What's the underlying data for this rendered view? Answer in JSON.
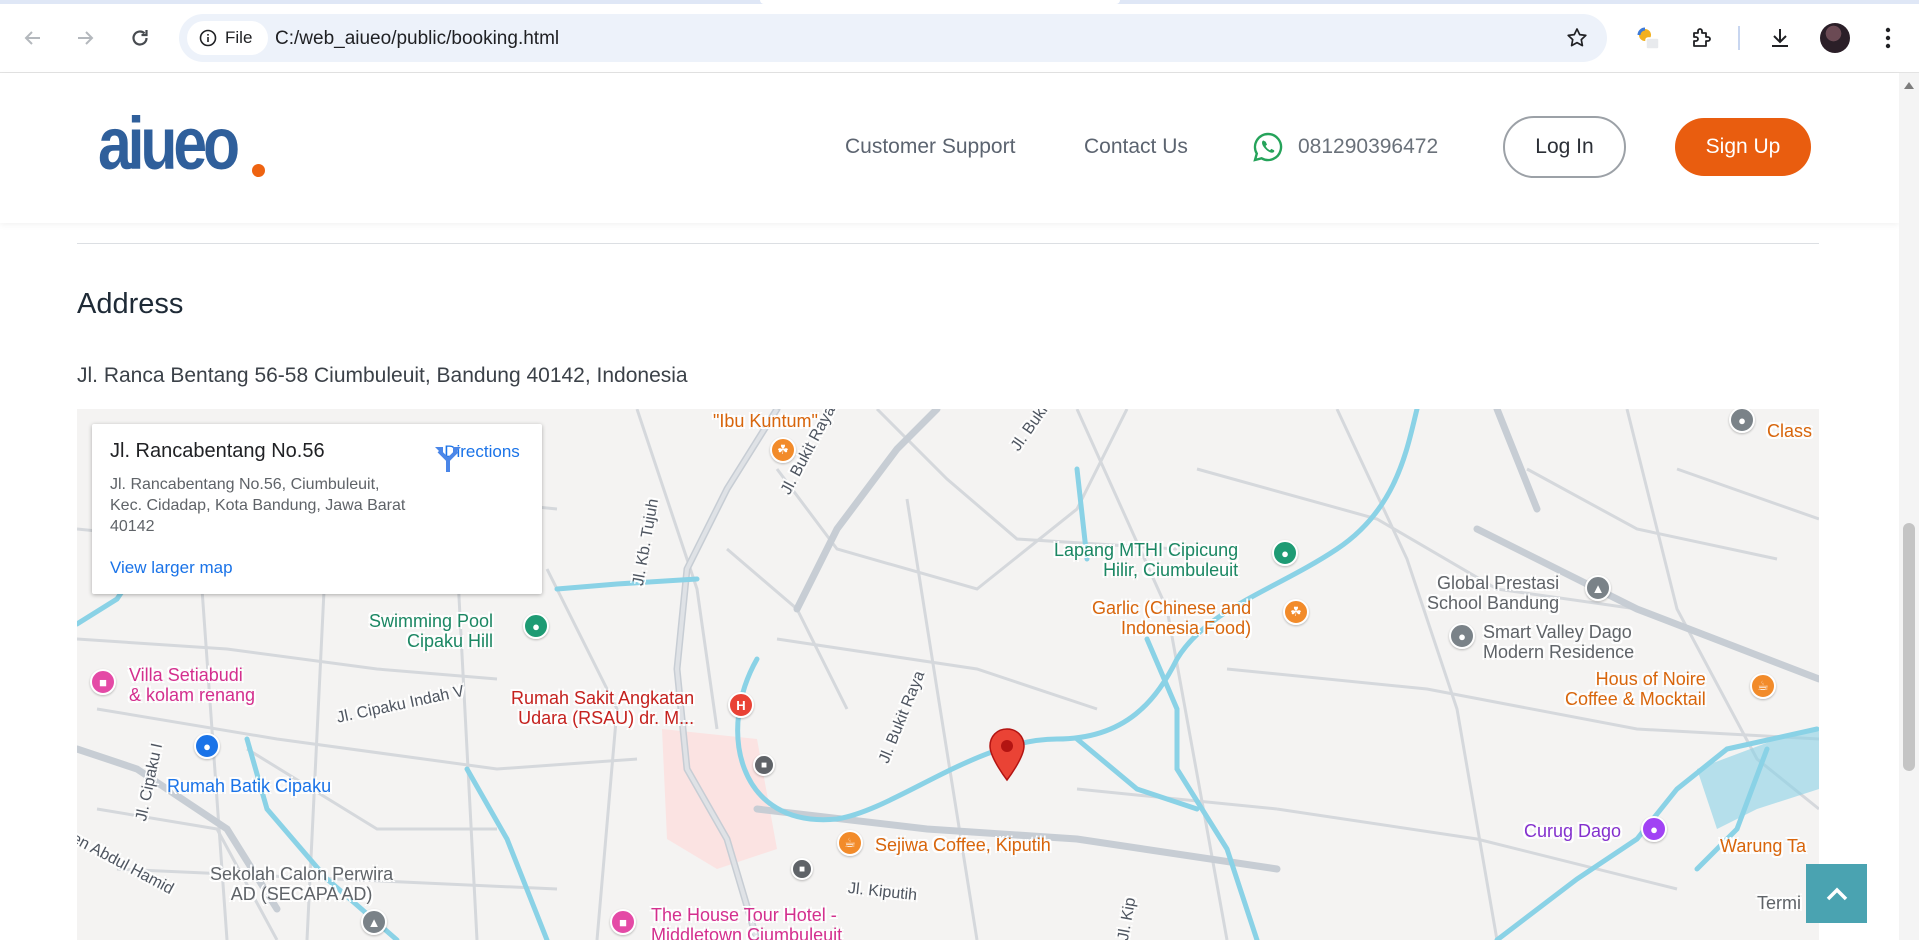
{
  "browser": {
    "chip_label": "File",
    "url": "C:/web_aiueo/public/booking.html"
  },
  "header": {
    "logo": "aiueo",
    "nav": [
      "Customer Support",
      "Contact Us"
    ],
    "phone": "081290396472",
    "login": "Log In",
    "signup": "Sign Up"
  },
  "address": {
    "title": "Address",
    "text": "Jl. Ranca Bentang 56-58 Ciumbuleuit, Bandung 40142, Indonesia"
  },
  "map": {
    "card_title": "Jl. Rancabentang No.56",
    "card_address": "Jl. Rancabentang No.56, Ciumbuleuit, Kec. Cidadap, Kota Bandung, Jawa Barat 40142",
    "directions": "Directions",
    "larger_map": "View larger map",
    "labels": {
      "ibu_kuntum": "\"Ibu Kuntum\"",
      "lapang": "Lapang MTHI Cipicung",
      "lapang2": "Hilir, Ciumbuleuit",
      "garlic": "Garlic (Chinese and",
      "garlic2": "Indonesia Food)",
      "global": "Global Prestasi",
      "global2": "School Bandung",
      "smart": "Smart Valley Dago",
      "smart2": "Modern Residence",
      "hous": "Hous of Noire",
      "hous2": "Coffee & Mocktail",
      "pool": "Swimming Pool",
      "pool2": "Cipaku Hill",
      "villa": "Villa Setiabudi",
      "villa2": "& kolam renang",
      "rsau": "Rumah Sakit Angkatan",
      "rsau2": "Udara (RSAU) dr. M...",
      "batik": "Rumah Batik Cipaku",
      "sejiwa": "Sejiwa Coffee, Kiputih",
      "curug": "Curug Dago",
      "warung": "Warung Ta",
      "sekolah": "Sekolah Calon Perwira",
      "sekolah2": "AD (SECAPA AD)",
      "house_tour": "The House Tour Hotel -",
      "house_tour2": "Middletown Ciumbuleuit",
      "class": "Class",
      "termi": "Termi",
      "road_kb": "Jl. Kb. Tujuh",
      "road_bukit_atas": "Jl. Bukit Raya Atas",
      "road_bukit": "Jl. Bukit Raya",
      "road_buki": "Jl. Buki",
      "road_cipaku": "Jl. Cipaku Indah V",
      "road_cipaku1": "Jl. Cipaku I",
      "road_abdul": "en Abdul Hamid",
      "road_kiputih": "Jl. Kiputih",
      "road_kip": "Jl. Kip"
    }
  },
  "colors": {
    "brand_blue": "#2f5f9b",
    "brand_orange": "#e95d0f",
    "scroll_top": "#4aa3b1"
  }
}
